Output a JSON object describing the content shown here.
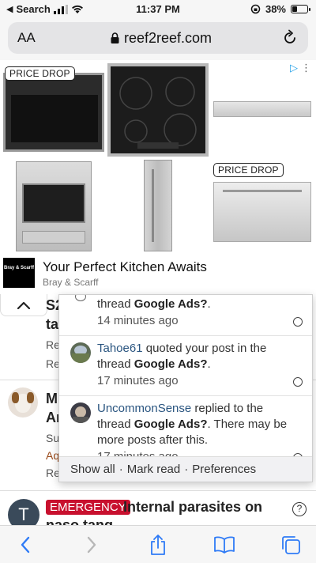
{
  "status_bar": {
    "carrier": "Search",
    "time": "11:37 PM",
    "battery": "38%",
    "battery_level": 0.38
  },
  "browser": {
    "text_size_label": "AA",
    "url": "reef2reef.com",
    "reload_icon": "reload-icon",
    "lock_icon": "lock-icon"
  },
  "ad": {
    "badge_1": "PRICE DROP",
    "badge_2": "PRICE DROP",
    "title": "Your Perfect Kitchen Awaits",
    "advertiser": "Bray & Scarff",
    "logo_text": "Bray & Scarff"
  },
  "background_threads": [
    {
      "title_fragment": "S2",
      "title_fragment_2": "ta",
      "meta_1": "Re",
      "meta_2": "Re"
    },
    {
      "title_fragment": "M",
      "title_fragment_2": "Ar",
      "meta_1": "Su",
      "meta_link": "Aq",
      "meta_2": "Re"
    }
  ],
  "alerts": [
    {
      "user": "",
      "action": "thread ",
      "thread": "Google Ads?",
      "suffix": ".",
      "time": "14 minutes ago"
    },
    {
      "user": "Tahoe61",
      "action": " quoted your post in the thread ",
      "thread": "Google Ads?",
      "suffix": ".",
      "time": "17 minutes ago"
    },
    {
      "user": "UncommonSense",
      "action": " replied to the thread ",
      "thread": "Google Ads?",
      "suffix": ". There may be more posts after this.",
      "time": "17 minutes ago"
    }
  ],
  "alerts_footer": {
    "show_all": "Show all",
    "mark_read": "Mark read",
    "preferences": "Preferences",
    "separator": "·"
  },
  "emergency_thread": {
    "avatar_letter": "T",
    "tag": "EMERGENCY",
    "title": "Internal parasites on",
    "title_line2": "naso tang",
    "help": "?"
  },
  "colors": {
    "link": "#2a5580",
    "emergency": "#c8102e",
    "adchoices": "#29a3e8"
  }
}
